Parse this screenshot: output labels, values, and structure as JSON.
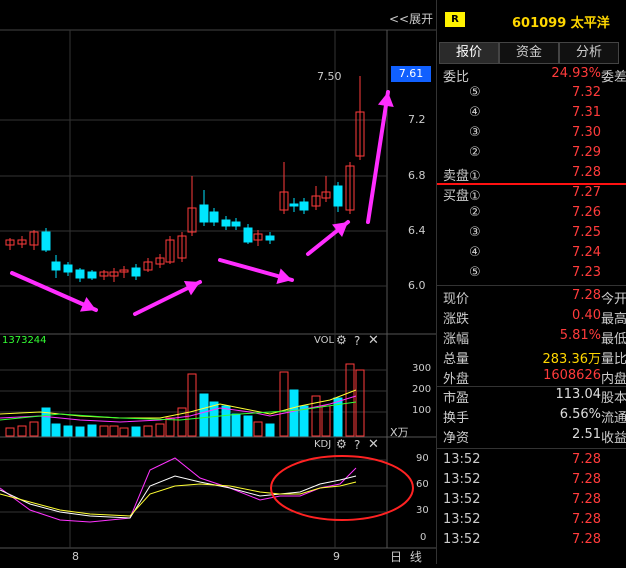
{
  "toolbar": {
    "expand_label": "<<展开"
  },
  "price_badge": "7.61",
  "price_axis": [
    "7.2",
    "6.8",
    "6.4",
    "6.0"
  ],
  "peak_label": "7.50",
  "volume_panel": {
    "title": "VOL",
    "value_label": "1373244",
    "axis": [
      "300",
      "200",
      "100"
    ],
    "unit": "X万"
  },
  "kdj_panel": {
    "title": "KDJ",
    "axis": [
      "90",
      "60",
      "30",
      "0"
    ]
  },
  "xaxis": {
    "labels": [
      "8",
      "9"
    ],
    "period": "日 线"
  },
  "stock": {
    "badge": "R",
    "code_name": "601099 太平洋"
  },
  "tabs": [
    "报价",
    "资金",
    "分析"
  ],
  "ratio": {
    "label": "委比",
    "value": "24.93%",
    "suffix": "委差"
  },
  "asks": [
    {
      "label": "⑤",
      "price": "7.32"
    },
    {
      "label": "④",
      "price": "7.31"
    },
    {
      "label": "③",
      "price": "7.30"
    },
    {
      "label": "②",
      "price": "7.29"
    },
    {
      "label": "卖盘①",
      "price": "7.28"
    }
  ],
  "bids": [
    {
      "label": "买盘①",
      "price": "7.27"
    },
    {
      "label": "②",
      "price": "7.26"
    },
    {
      "label": "③",
      "price": "7.25"
    },
    {
      "label": "④",
      "price": "7.24"
    },
    {
      "label": "⑤",
      "price": "7.23"
    }
  ],
  "stats": [
    {
      "label": "现价",
      "value": "7.28",
      "suffix": "今开",
      "color": "red"
    },
    {
      "label": "涨跌",
      "value": "0.40",
      "suffix": "最高",
      "color": "red"
    },
    {
      "label": "涨幅",
      "value": "5.81%",
      "suffix": "最低",
      "color": "red"
    },
    {
      "label": "总量",
      "value": "283.36万",
      "suffix": "量比",
      "color": "yellow"
    },
    {
      "label": "外盘",
      "value": "1608626",
      "suffix": "内盘",
      "color": "red"
    }
  ],
  "stats2": [
    {
      "label": "市盈",
      "value": "113.04",
      "suffix": "股本",
      "color": "white"
    },
    {
      "label": "换手",
      "value": "6.56%",
      "suffix": "流通",
      "color": "white"
    },
    {
      "label": "净资",
      "value": "2.51",
      "suffix": "收益(二",
      "color": "white"
    }
  ],
  "ticks": [
    {
      "time": "13:52",
      "price": "7.28"
    },
    {
      "time": "13:52",
      "price": "7.28"
    },
    {
      "time": "13:52",
      "price": "7.28"
    },
    {
      "time": "13:52",
      "price": "7.28"
    },
    {
      "time": "13:52",
      "price": "7.28"
    }
  ],
  "colors": {
    "up": "#ff3b3b",
    "down": "#00e5ff",
    "arrow": "#ff2dff",
    "ma_white": "#ffffff",
    "ma_yellow": "#ffff33",
    "ma_magenta": "#ff33ff",
    "ma_green": "#33ff33",
    "circle": "#ff2222"
  },
  "icons": [
    "gear-icon",
    "help-icon",
    "close-icon"
  ]
}
